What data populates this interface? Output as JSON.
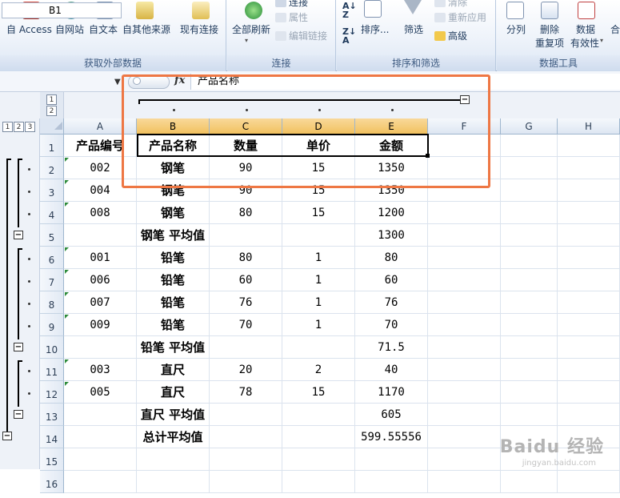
{
  "ribbon": {
    "groups": [
      {
        "title": "获取外部数据",
        "buttons": [
          "自 Access",
          "自网站",
          "自文本",
          "自其他来源",
          "现有连接"
        ]
      },
      {
        "title": "连接",
        "buttons": [
          "全部刷新"
        ],
        "small": [
          "连接",
          "属性",
          "编辑链接"
        ]
      },
      {
        "title": "排序和筛选",
        "buttons": [
          "排序...",
          "筛选"
        ],
        "small": [
          "清除",
          "重新应用",
          "高级"
        ]
      },
      {
        "title": "数据工具",
        "buttons": [
          "分列",
          "删除",
          "重复项",
          "数据",
          "有效性",
          "合"
        ]
      }
    ]
  },
  "formula_bar": {
    "name_box": "B1",
    "fx": "fx",
    "content": "产品名称"
  },
  "outline": {
    "row_levels": [
      "1",
      "2",
      "3"
    ],
    "col_levels": [
      "1",
      "2"
    ]
  },
  "columns": [
    "A",
    "B",
    "C",
    "D",
    "E",
    "F",
    "G",
    "H"
  ],
  "rows": [
    {
      "n": "1",
      "a": "产品编号",
      "b": "产品名称",
      "c": "数量",
      "d": "单价",
      "e": "金额"
    },
    {
      "n": "2",
      "a": "002",
      "b": "钢笔",
      "c": "90",
      "d": "15",
      "e": "1350"
    },
    {
      "n": "3",
      "a": "004",
      "b": "钢笔",
      "c": "90",
      "d": "15",
      "e": "1350"
    },
    {
      "n": "4",
      "a": "008",
      "b": "钢笔",
      "c": "80",
      "d": "15",
      "e": "1200"
    },
    {
      "n": "5",
      "a": "",
      "b": "钢笔 平均值",
      "c": "",
      "d": "",
      "e": "1300"
    },
    {
      "n": "6",
      "a": "001",
      "b": "铅笔",
      "c": "80",
      "d": "1",
      "e": "80"
    },
    {
      "n": "7",
      "a": "006",
      "b": "铅笔",
      "c": "60",
      "d": "1",
      "e": "60"
    },
    {
      "n": "8",
      "a": "007",
      "b": "铅笔",
      "c": "76",
      "d": "1",
      "e": "76"
    },
    {
      "n": "9",
      "a": "009",
      "b": "铅笔",
      "c": "70",
      "d": "1",
      "e": "70"
    },
    {
      "n": "10",
      "a": "",
      "b": "铅笔 平均值",
      "c": "",
      "d": "",
      "e": "71.5"
    },
    {
      "n": "11",
      "a": "003",
      "b": "直尺",
      "c": "20",
      "d": "2",
      "e": "40"
    },
    {
      "n": "12",
      "a": "005",
      "b": "直尺",
      "c": "78",
      "d": "15",
      "e": "1170"
    },
    {
      "n": "13",
      "a": "",
      "b": "直尺 平均值",
      "c": "",
      "d": "",
      "e": "605"
    },
    {
      "n": "14",
      "a": "",
      "b": "总计平均值",
      "c": "",
      "d": "",
      "e": "599.55556"
    },
    {
      "n": "15",
      "a": "",
      "b": "",
      "c": "",
      "d": "",
      "e": ""
    },
    {
      "n": "16",
      "a": "",
      "b": "",
      "c": "",
      "d": "",
      "e": ""
    }
  ],
  "watermark": {
    "text": "Baidu 经验",
    "sub": "jingyan.baidu.com"
  },
  "colors": {
    "selected_header": "#f1c15f",
    "highlight": "#ee7744",
    "ribbon_text": "#1e395b"
  }
}
